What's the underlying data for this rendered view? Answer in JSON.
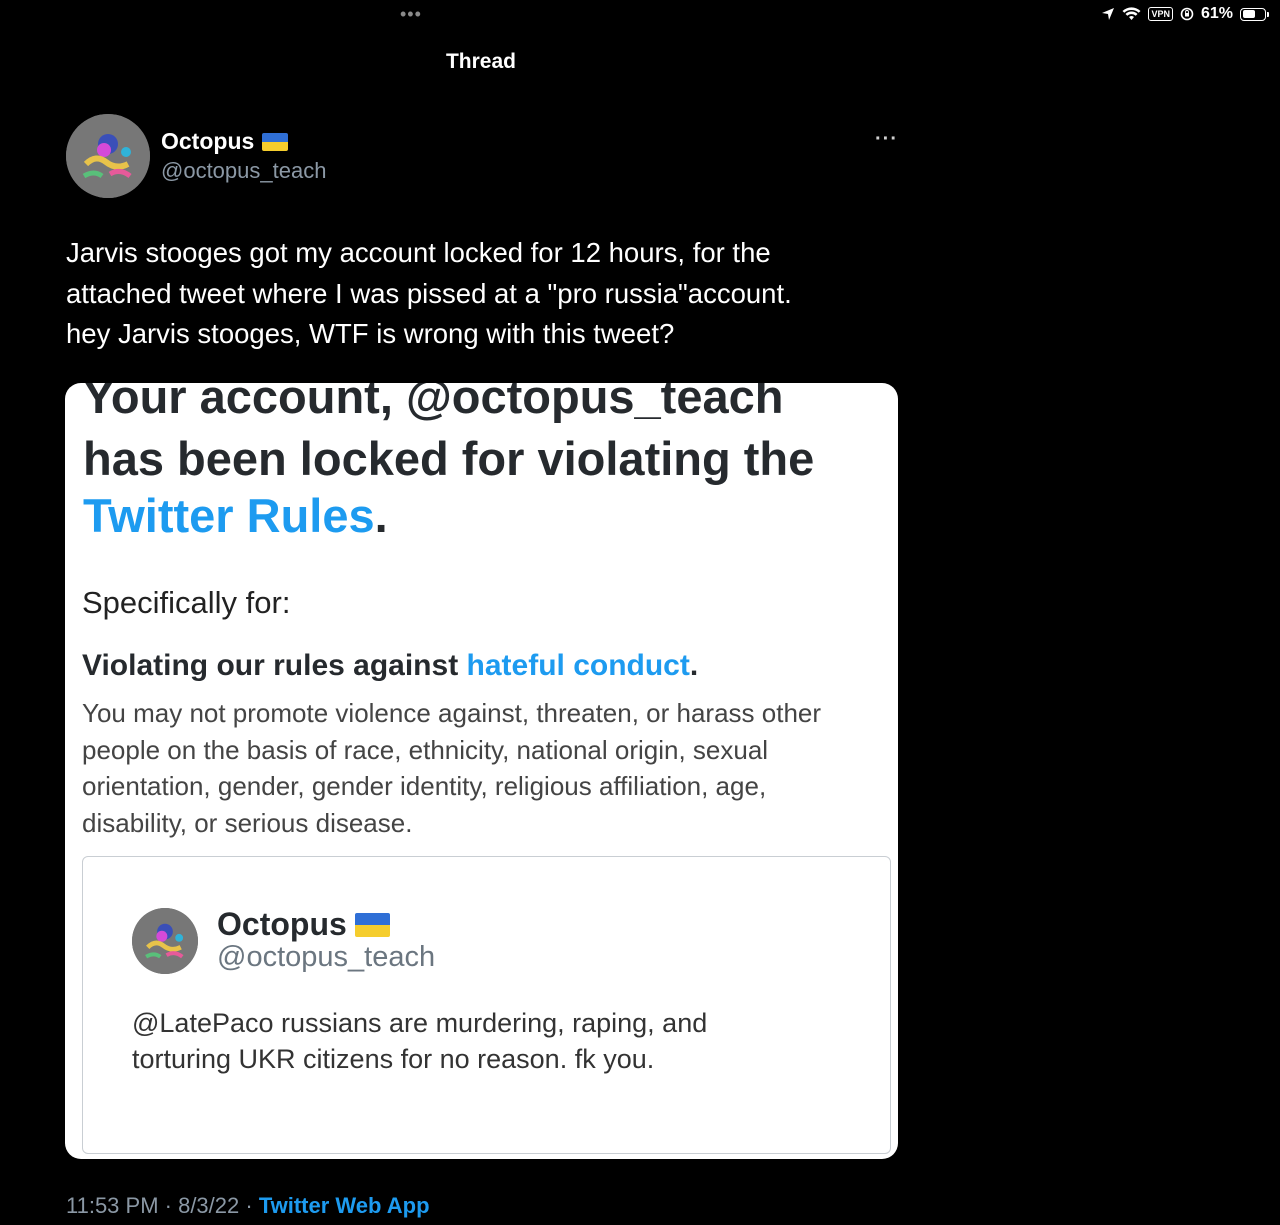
{
  "status_bar": {
    "multitask": "•••",
    "vpn": "VPN",
    "battery": "61%",
    "battery_level": 0.61
  },
  "nav": {
    "title": "Thread"
  },
  "tweet": {
    "author_name": "Octopus",
    "author_handle": "@octopus_teach",
    "more": "···",
    "text_lines": [
      "Jarvis stooges got my account locked for 12 hours, for the",
      "attached tweet where I was pissed at a \"pro russia\"account.",
      "hey Jarvis stooges, WTF is wrong with this tweet?"
    ],
    "timestamp": "11:53 PM · 8/3/22 · ",
    "source": "Twitter Web App"
  },
  "media": {
    "lock_line1": "Your account, @octopus_teach",
    "lock_line2": "has been locked for violating the",
    "lock_link": "Twitter Rules",
    "lock_period": ".",
    "specifically": "Specifically for:",
    "violate_prefix": "Violating our rules against ",
    "violate_link": "hateful conduct",
    "violate_period": ".",
    "rule_lines": [
      "You may not promote violence against, threaten, or harass other",
      "people on the basis of race, ethnicity, national origin, sexual",
      "orientation, gender, gender identity, religious affiliation, age,",
      "disability, or serious disease."
    ],
    "quoted": {
      "name": "Octopus",
      "handle": "@octopus_teach",
      "text_lines": [
        "@LatePaco russians are murdering, raping, and",
        "torturing UKR citizens for no reason. fk you."
      ]
    }
  },
  "colors": {
    "link": "#1d9bf0",
    "background": "#000000",
    "flag_blue": "#2f6fd6",
    "flag_yellow": "#f5cd2d"
  }
}
